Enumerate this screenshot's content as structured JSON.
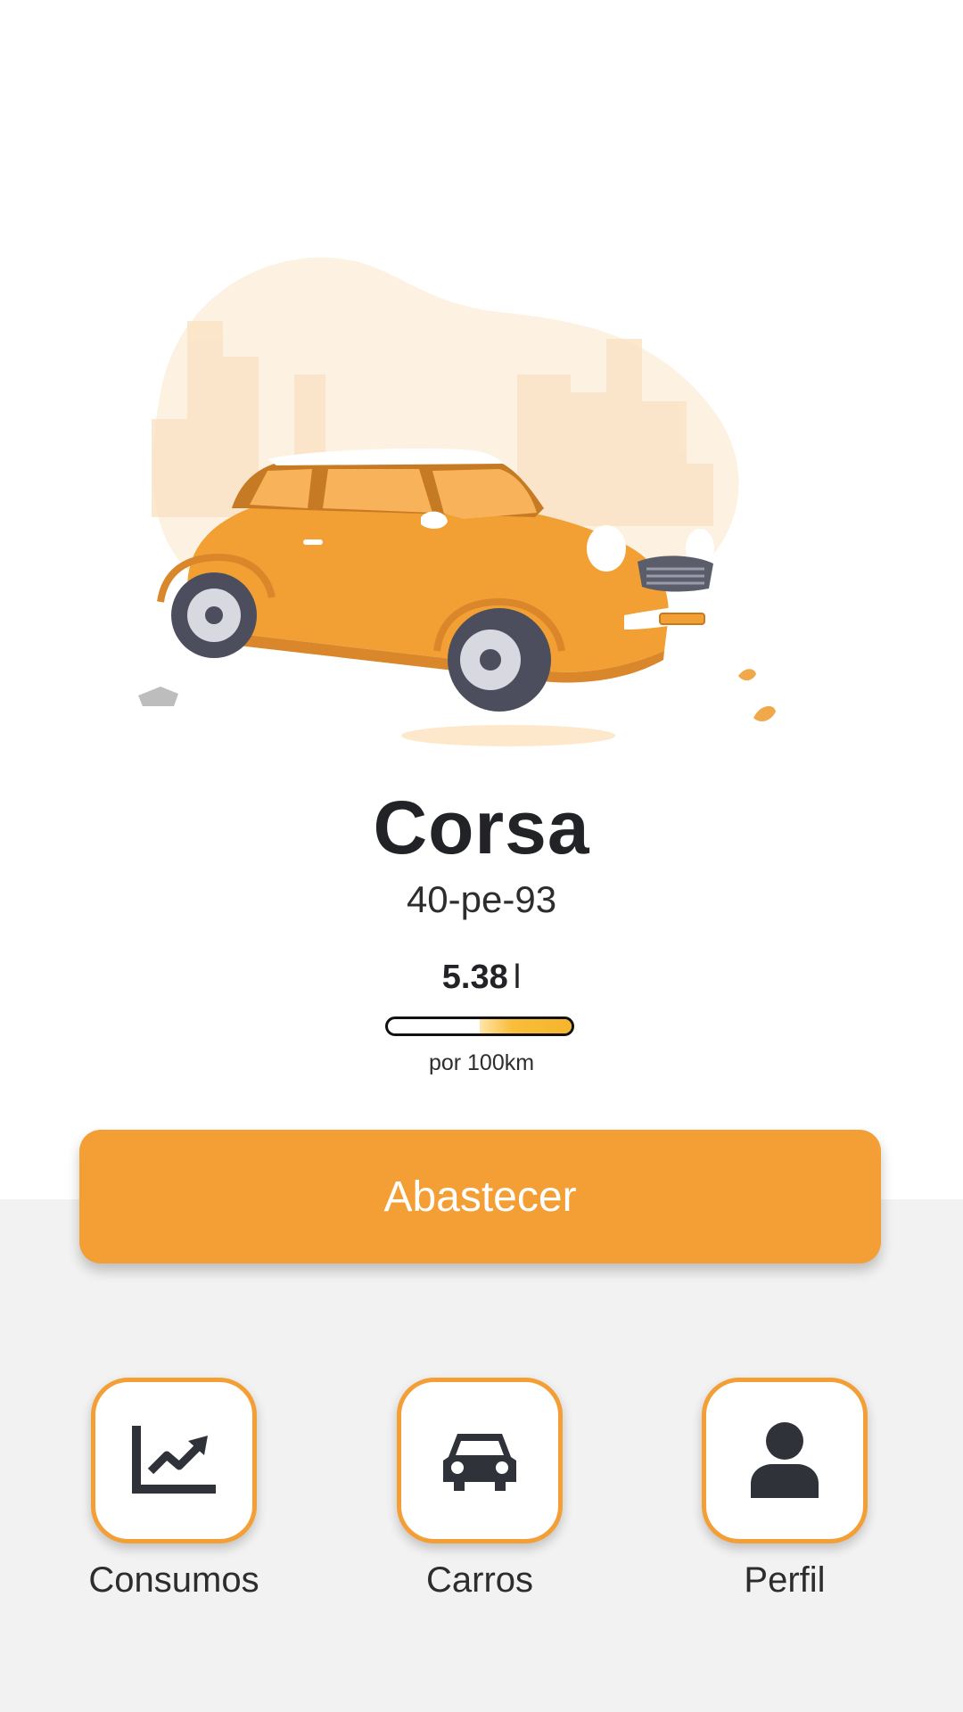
{
  "car": {
    "name": "Corsa",
    "plate": "40-pe-93"
  },
  "consumption": {
    "value": "5.38",
    "unit": "l",
    "caption": "por 100km",
    "gauge_level_fraction": 0.5
  },
  "actions": {
    "refuel_label": "Abastecer"
  },
  "nav": {
    "items": [
      {
        "label": "Consumos",
        "icon": "trending-chart-icon"
      },
      {
        "label": "Carros",
        "icon": "car-icon"
      },
      {
        "label": "Perfil",
        "icon": "user-icon"
      }
    ]
  },
  "colors": {
    "accent": "#f39f35",
    "text_dark": "#222326",
    "panel_background": "#f2f2f2",
    "gauge_fill": "#f5b52c"
  }
}
